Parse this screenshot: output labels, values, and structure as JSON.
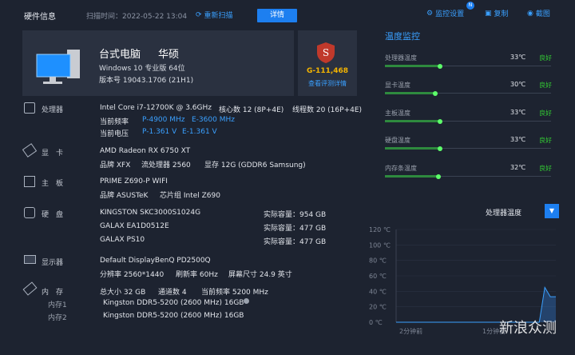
{
  "header": {
    "title": "硬件信息",
    "scan_time": "扫描时间：2022-05-22 13:04",
    "rescan_label": "重新扫描",
    "detail_label": "详情",
    "monitor_settings": "监控设置",
    "copy": "复制",
    "screenshot": "截图",
    "badge": "N"
  },
  "pc": {
    "name": "台式电脑",
    "brand": "华硕",
    "os": "Windows 10 专业版 64位",
    "version": "版本号  19043.1706 (21H1)"
  },
  "score": {
    "value": "G-111,468",
    "link": "查看评测详情",
    "letter": "S"
  },
  "sections": {
    "cpu": {
      "label": "处理器",
      "model": "Intel Core i7-12700K @ 3.6GHz",
      "cores": "核心数  12 (8P+4E)",
      "threads": "线程数  20 (16P+4E)",
      "freq_label": "当前频率",
      "freq_p": "P-4900 MHz",
      "freq_e": "E-3600 MHz",
      "volt_label": "当前电压",
      "volt_p": "P-1.361 V",
      "volt_e": "E-1.361 V"
    },
    "gpu": {
      "label": "显　卡",
      "model": "AMD Radeon RX 6750 XT",
      "brand": "品牌  XFX",
      "stream": "流处理器  2560",
      "vram": "显存  12G (GDDR6 Samsung)"
    },
    "board": {
      "label": "主　板",
      "model": "PRIME Z690-P WIFI",
      "brand": "品牌  ASUSTeK",
      "chipset": "芯片组  Intel Z690"
    },
    "disk": {
      "label": "硬　盘",
      "rows": [
        {
          "name": "KINGSTON SKC3000S1024G",
          "cap": "实际容量：954 GB"
        },
        {
          "name": "GALAX EA1D0512E",
          "cap": "实际容量：477 GB"
        },
        {
          "name": "GALAX PS10",
          "cap": "实际容量：477 GB"
        }
      ]
    },
    "display": {
      "label": "显示器",
      "model": "Default DisplayBenQ PD2500Q",
      "res": "分辨率  2560*1440",
      "refresh": "刷新率 60Hz",
      "size": "屏幕尺寸  24.9 英寸"
    },
    "memory": {
      "label": "内　存",
      "total": "总大小  32 GB",
      "channels": "通道数  4",
      "freq": "当前频率  5200 MHz",
      "slot1_label": "内存1",
      "slot1": "Kingston DDR5-5200 (2600 MHz) 16GB",
      "slot2_label": "内存2",
      "slot2": "Kingston DDR5-5200 (2600 MHz) 16GB"
    }
  },
  "monitor": {
    "title": "温度监控",
    "rows": [
      {
        "name": "处理器温度",
        "value": "33℃",
        "status": "良好"
      },
      {
        "name": "显卡温度",
        "value": "30℃",
        "status": "良好"
      },
      {
        "name": "主板温度",
        "value": "33℃",
        "status": "良好"
      },
      {
        "name": "硬盘温度",
        "value": "33℃",
        "status": "良好"
      },
      {
        "name": "内存条温度",
        "value": "32℃",
        "status": "良好"
      }
    ],
    "select_value": "处理器温度"
  },
  "chart_data": {
    "type": "line",
    "yticks": [
      "120 ℃",
      "100 ℃",
      "80 ℃",
      "60 ℃",
      "40 ℃",
      "20 ℃",
      "0 ℃"
    ],
    "ylim": [
      0,
      120
    ],
    "xticks": [
      "2分钟前",
      "1分钟前"
    ],
    "series": [
      {
        "values": [
          0,
          0,
          0,
          0,
          0,
          0,
          0,
          0,
          0,
          0,
          0,
          0,
          0,
          0,
          0,
          0,
          0,
          0,
          0,
          0,
          0,
          0,
          0,
          0,
          0,
          0,
          0,
          45,
          33,
          33
        ]
      }
    ]
  },
  "watermark": "新浪众测",
  "colors": {
    "accent": "#1d7ff0",
    "good": "#33cc33",
    "bar": "#5dff6a"
  }
}
